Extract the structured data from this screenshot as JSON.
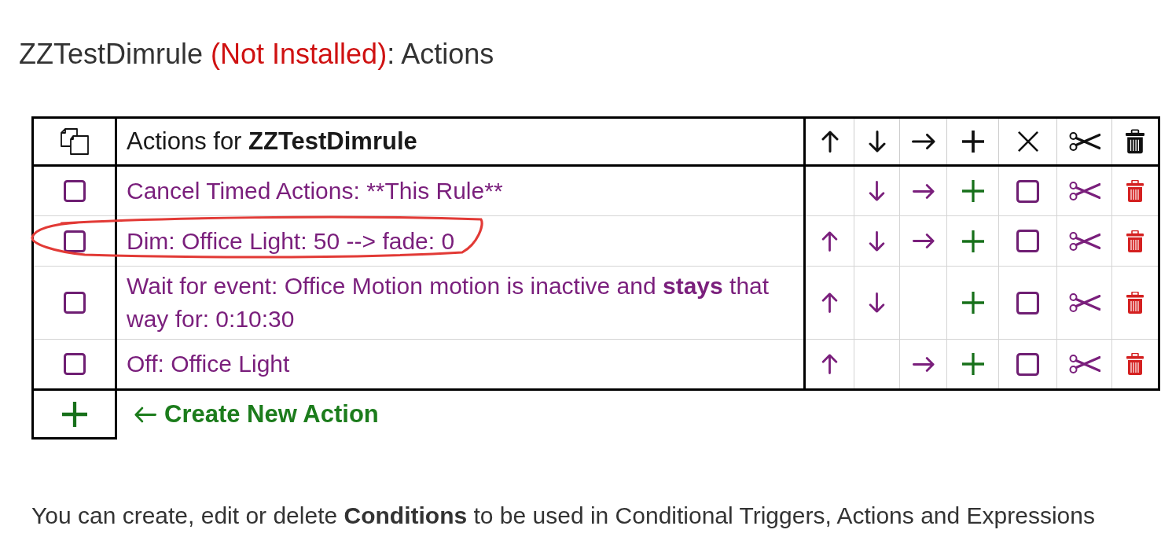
{
  "title": {
    "name": "ZZTestDimrule",
    "status": "(Not Installed)",
    "suffix": ": Actions"
  },
  "table": {
    "heading": "Actions for **ZZTestDimrule**",
    "actions": [
      {
        "label": "Cancel Timed Actions: **This Rule**",
        "markup": false,
        "checked": false,
        "up": false,
        "down": true,
        "right": true,
        "x_checked": false,
        "circled": false
      },
      {
        "label": "Dim: Office Light: 50 --> fade: 0",
        "markup": false,
        "checked": false,
        "up": true,
        "down": true,
        "right": true,
        "x_checked": false,
        "circled": true
      },
      {
        "label": "Wait for event: Office Motion motion is inactive and **stays** that way for: 0:10:30",
        "markup": true,
        "checked": false,
        "up": true,
        "down": true,
        "right": false,
        "x_checked": false,
        "circled": false
      },
      {
        "label": "Off: Office Light",
        "markup": false,
        "checked": false,
        "up": true,
        "down": false,
        "right": true,
        "x_checked": false,
        "circled": false
      }
    ],
    "create_action": {
      "label": "Create New Action"
    }
  },
  "footer": "You can create, edit or delete **Conditions** to be used in Conditional Triggers, Actions and Expressions"
}
